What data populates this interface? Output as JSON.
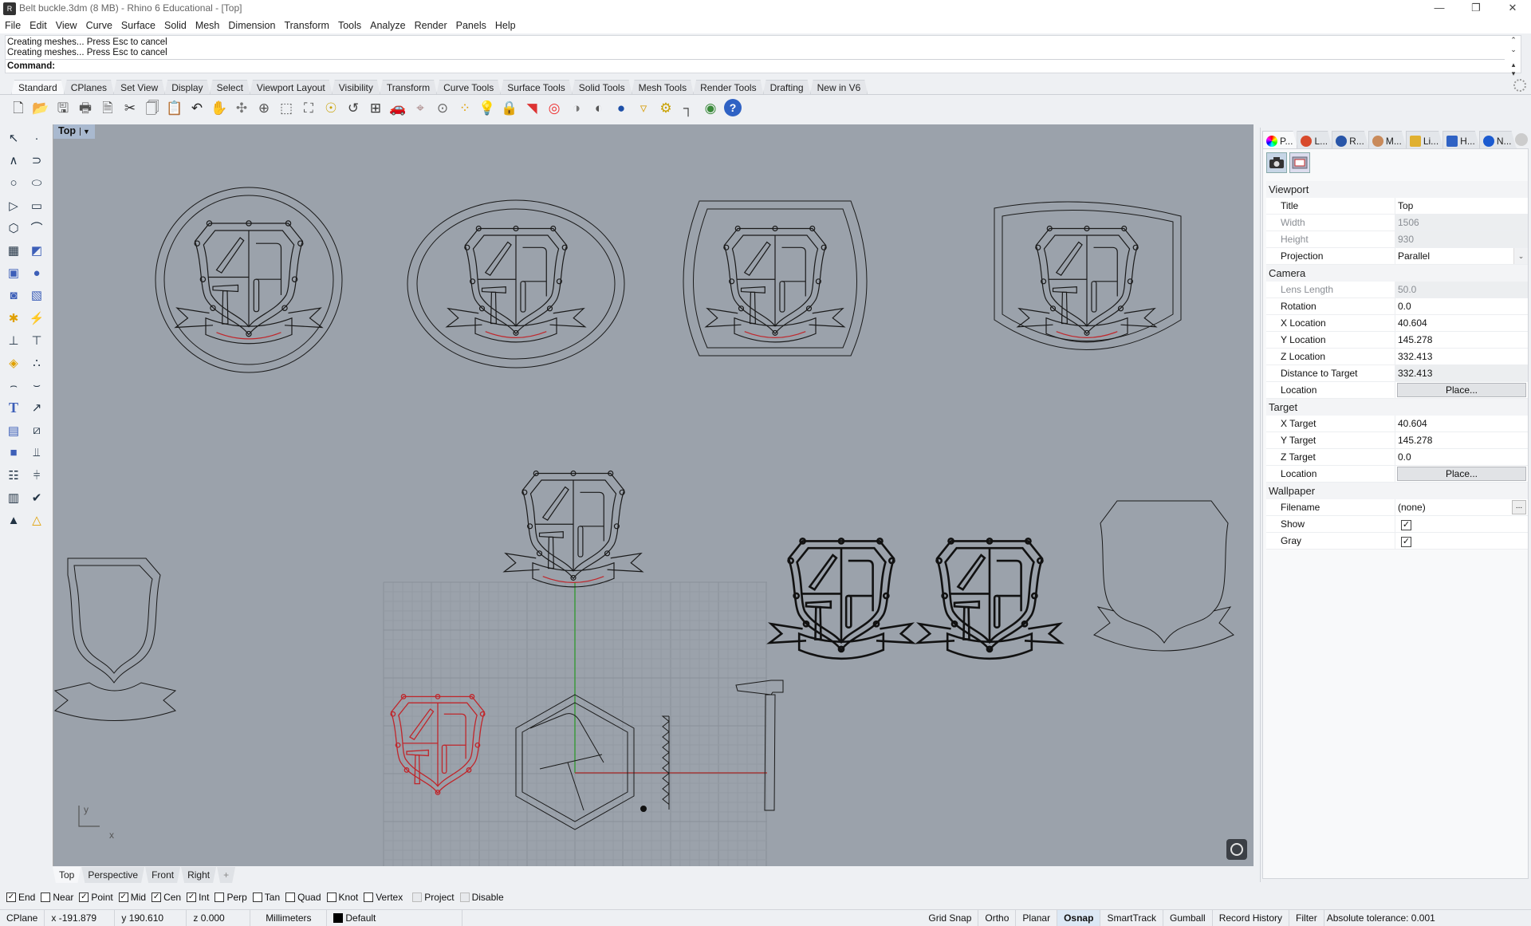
{
  "window": {
    "title": "Belt buckle.3dm (8 MB) - Rhino 6 Educational - [Top]",
    "controls": {
      "minimize": "—",
      "restore": "❐",
      "close": "✕"
    }
  },
  "menu": [
    "File",
    "Edit",
    "View",
    "Curve",
    "Surface",
    "Solid",
    "Mesh",
    "Dimension",
    "Transform",
    "Tools",
    "Analyze",
    "Render",
    "Panels",
    "Help"
  ],
  "command": {
    "history": [
      "Creating meshes... Press Esc to cancel",
      "Creating meshes... Press Esc to cancel"
    ],
    "prompt": "Command:",
    "value": ""
  },
  "toolbar_tabs": [
    "Standard",
    "CPlanes",
    "Set View",
    "Display",
    "Select",
    "Viewport Layout",
    "Visibility",
    "Transform",
    "Curve Tools",
    "Surface Tools",
    "Solid Tools",
    "Mesh Tools",
    "Render Tools",
    "Drafting",
    "New in V6"
  ],
  "active_toolbar_tab": "Standard",
  "standard_icons": [
    "new-file-icon",
    "open-file-icon",
    "save-icon",
    "print-icon",
    "import-icon",
    "cut-icon",
    "copy-icon",
    "paste-icon",
    "undo-icon",
    "pan-icon",
    "rotate-view-icon",
    "zoom-dynamic-icon",
    "zoom-window-icon",
    "zoom-extents-icon",
    "zoom-selected-icon",
    "undo-view-icon",
    "four-viewports-icon",
    "car-icon",
    "cplane-icon",
    "osnap-icon",
    "points-on-icon",
    "light-icon",
    "lock-icon",
    "layer-icon",
    "color-wheel-icon",
    "display-shaded-icon",
    "display-rendered-icon",
    "render-sphere-icon",
    "select-filter-icon",
    "options-gear-icon",
    "dimension-icon",
    "grasshopper-icon",
    "help-icon"
  ],
  "toolbox_icons": [
    [
      "select-arrow-icon",
      "point-icon"
    ],
    [
      "polyline-icon",
      "curve-icon"
    ],
    [
      "circle-icon",
      "ellipse-icon"
    ],
    [
      "arc-icon",
      "rectangle-icon"
    ],
    [
      "polygon-icon",
      "fillet-curve-icon"
    ],
    [
      "surface-corner-points-icon",
      "extrude-surface-icon"
    ],
    [
      "box-icon",
      "boolean-union-icon"
    ],
    [
      "extrude-solid-icon",
      "mesh-icon"
    ],
    [
      "explode-icon",
      "split-icon"
    ],
    [
      "trim-icon",
      "split-tool-icon"
    ],
    [
      "boolean-split-icon",
      "group-icon"
    ],
    [
      "offset-icon",
      "fillet-edges-icon"
    ],
    [
      "text-icon",
      "move-icon"
    ],
    [
      "array-icon",
      "scale-icon"
    ],
    [
      "block-icon",
      "project-icon"
    ],
    [
      "array-grid-icon",
      "analyze-icon"
    ],
    [
      "map-icon",
      "check-icon"
    ],
    [
      "render-icon",
      "light-pyramid-icon"
    ]
  ],
  "viewport": {
    "title": "Top",
    "axis_x": "x",
    "axis_y": "y",
    "background": "#9ba2ab",
    "curve_color": "#1a1a1a",
    "selected_color": "#c0262b",
    "x_axis_color": "#a33a3a",
    "y_axis_color": "#3c9a3c"
  },
  "viewport_tabs": [
    "Top",
    "Perspective",
    "Front",
    "Right"
  ],
  "active_viewport_tab": "Top",
  "osnap": [
    {
      "label": "End",
      "checked": true,
      "enabled": true
    },
    {
      "label": "Near",
      "checked": false,
      "enabled": true
    },
    {
      "label": "Point",
      "checked": true,
      "enabled": true
    },
    {
      "label": "Mid",
      "checked": true,
      "enabled": true
    },
    {
      "label": "Cen",
      "checked": true,
      "enabled": true
    },
    {
      "label": "Int",
      "checked": true,
      "enabled": true
    },
    {
      "label": "Perp",
      "checked": false,
      "enabled": true
    },
    {
      "label": "Tan",
      "checked": false,
      "enabled": true
    },
    {
      "label": "Quad",
      "checked": false,
      "enabled": true
    },
    {
      "label": "Knot",
      "checked": false,
      "enabled": true
    },
    {
      "label": "Vertex",
      "checked": false,
      "enabled": true
    },
    {
      "label": "Project",
      "checked": false,
      "enabled": false
    },
    {
      "label": "Disable",
      "checked": false,
      "enabled": false
    }
  ],
  "status": {
    "cplane": "CPlane",
    "x": "x -191.879",
    "y": "y 190.610",
    "z": "z 0.000",
    "units": "Millimeters",
    "layer": "Default",
    "layer_color": "#000000",
    "toggles": [
      "Grid Snap",
      "Ortho",
      "Planar",
      "Osnap",
      "SmartTrack",
      "Gumball",
      "Record History",
      "Filter"
    ],
    "active_toggles": [
      "Osnap"
    ],
    "tolerance": "Absolute tolerance: 0.001"
  },
  "panel": {
    "tabs": [
      {
        "label": "P...",
        "icon": "properties-color-wheel-icon"
      },
      {
        "label": "L...",
        "icon": "layers-icon"
      },
      {
        "label": "R...",
        "icon": "render-icon"
      },
      {
        "label": "M...",
        "icon": "materials-icon"
      },
      {
        "label": "Li...",
        "icon": "libraries-folder-icon"
      },
      {
        "label": "H...",
        "icon": "help-icon"
      },
      {
        "label": "N...",
        "icon": "notifications-bell-icon"
      }
    ],
    "sections": {
      "viewport": {
        "label": "Viewport",
        "title_label": "Title",
        "title": "Top",
        "width_label": "Width",
        "width": "1506",
        "height_label": "Height",
        "height": "930",
        "projection_label": "Projection",
        "projection": "Parallel"
      },
      "camera": {
        "label": "Camera",
        "lens_label": "Lens Length",
        "lens": "50.0",
        "rotation_label": "Rotation",
        "rotation": "0.0",
        "xloc_label": "X Location",
        "xloc": "40.604",
        "yloc_label": "Y Location",
        "yloc": "145.278",
        "zloc_label": "Z Location",
        "zloc": "332.413",
        "dist_label": "Distance to Target",
        "dist": "332.413",
        "location_label": "Location",
        "place": "Place..."
      },
      "target": {
        "label": "Target",
        "x_label": "X Target",
        "x": "40.604",
        "y_label": "Y Target",
        "y": "145.278",
        "z_label": "Z Target",
        "z": "0.0",
        "location_label": "Location",
        "place": "Place..."
      },
      "wallpaper": {
        "label": "Wallpaper",
        "filename_label": "Filename",
        "filename": "(none)",
        "browse": "...",
        "show_label": "Show",
        "show": true,
        "gray_label": "Gray",
        "gray": true
      }
    }
  }
}
